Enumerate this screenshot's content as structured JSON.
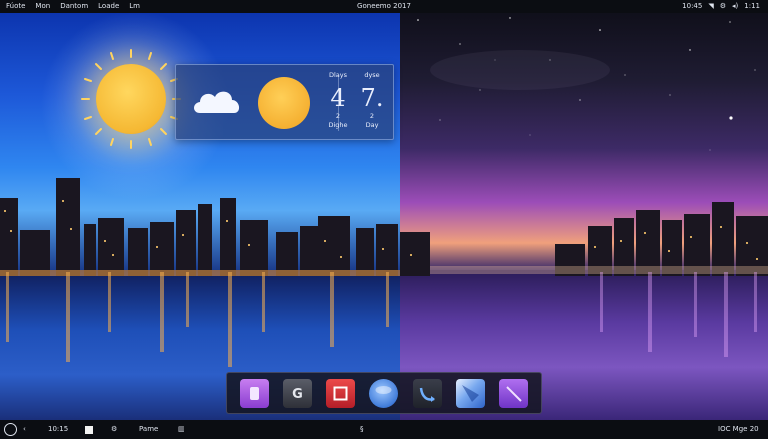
{
  "topbar": {
    "menu": [
      "Fúote",
      "Mon",
      "Dantom",
      "Loade",
      "Lm"
    ],
    "title": "Goneemo 2017",
    "clock": "10:45",
    "tray_extra": "1:11"
  },
  "weather": {
    "col1": {
      "head": "Dlays",
      "big": "4",
      "small1": "2",
      "small2": "Dighe"
    },
    "col2": {
      "head": "dyse",
      "big": "7.",
      "small1": "2",
      "small2": "Day"
    },
    "icons": [
      "cloud-icon",
      "sun-icon"
    ]
  },
  "dock": {
    "items": [
      {
        "name": "purple-app",
        "color": "#a45ce0"
      },
      {
        "name": "g-app",
        "glyph": "G",
        "color": "#3c3f48"
      },
      {
        "name": "red-app",
        "color": "#d93438"
      },
      {
        "name": "blue-orb-app",
        "color": "#4a86e0"
      },
      {
        "name": "curved-arrow-app",
        "color": "#2a2d36"
      },
      {
        "name": "pen-app",
        "color": "#5f8fe0"
      },
      {
        "name": "violet-line-app",
        "color": "#9052dc"
      }
    ]
  },
  "taskbar": {
    "time": "10:15",
    "label": "Pame",
    "right_text": "IOC Mge 20"
  },
  "colors": {
    "day_sky": "#1d58d8",
    "night_sky": "#3d2a66",
    "panel_bg": "#0b0d12",
    "sun": "#f5b833"
  }
}
